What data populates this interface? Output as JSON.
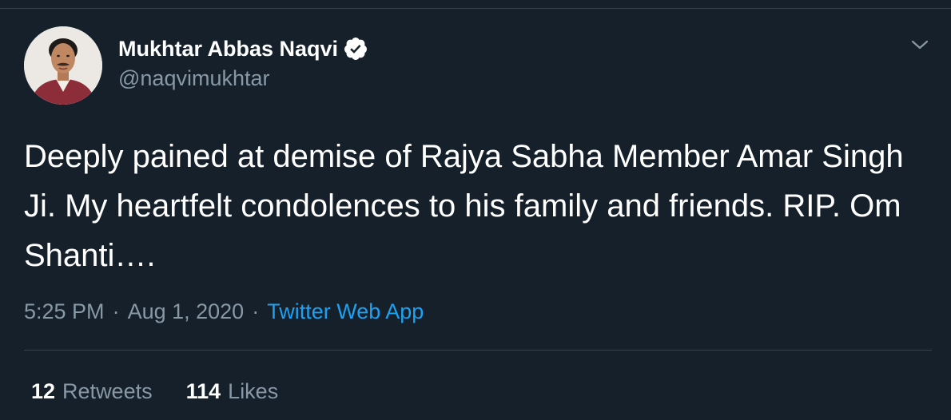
{
  "tweet": {
    "author": {
      "display_name": "Mukhtar Abbas Naqvi",
      "handle": "@naqvimukhtar",
      "verified": true,
      "avatar_icon": "profile-photo"
    },
    "menu_icon": "chevron-down-icon",
    "text": "Deeply pained at demise of Rajya Sabha Member Amar Singh Ji. My heartfelt condolences to his family and friends. RIP. Om Shanti….",
    "meta": {
      "time": "5:25 PM",
      "separator": "·",
      "date": "Aug 1, 2020",
      "source": "Twitter Web App"
    },
    "stats": {
      "retweets_count": "12",
      "retweets_label": "Retweets",
      "likes_count": "114",
      "likes_label": "Likes"
    }
  },
  "colors": {
    "background": "#15202b",
    "primary_text": "#ffffff",
    "secondary_text": "#8899a6",
    "accent": "#1da1f2",
    "border": "#38444d"
  }
}
